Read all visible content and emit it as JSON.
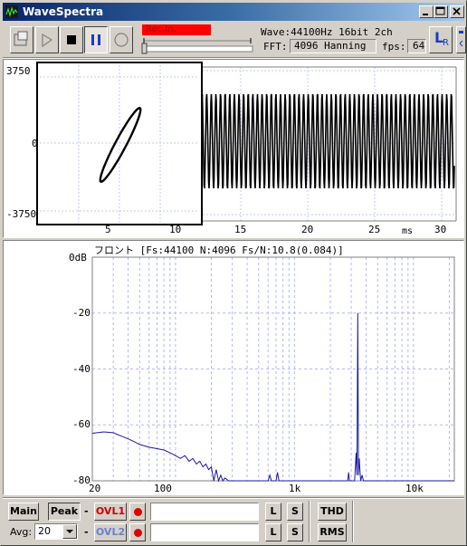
{
  "window": {
    "title": "WaveSpectra",
    "controls": [
      "minimize",
      "maximize",
      "close"
    ]
  },
  "toolbar": {
    "record_indicator": "Rec.In.",
    "wave_info": "Wave:44100Hz 16bit 2ch",
    "fft_label": "FFT:",
    "fft_value": "4096 Hanning",
    "fps_label": "fps:",
    "fps_value": "64",
    "lr_label": "L",
    "lr_sub": "R"
  },
  "wave_view": {
    "y_top": "3750",
    "y_mid": "0",
    "y_bottom": "-3750",
    "x_ticks": [
      "5",
      "10",
      "15",
      "20",
      "25",
      "30"
    ],
    "x_unit": "ms"
  },
  "spectrum_view": {
    "header": "フロント  [Fs:44100 N:4096 Fs/N:10.8(0.084)]",
    "y_ticks": [
      "0dB",
      "-20",
      "-40",
      "-60",
      "-80"
    ],
    "x_ticks": [
      "20",
      "100",
      "1k",
      "10k"
    ]
  },
  "bottom": {
    "main_label": "Main",
    "peak_label": "Peak",
    "dash": "-",
    "ovl1_label": "OVL1",
    "ovl2_label": "OVL2",
    "l_label": "L",
    "s_label": "S",
    "thd_label": "THD",
    "rms_label": "RMS",
    "avg_label": "Avg:",
    "avg_value": "20"
  },
  "colors": {
    "title_start": "#0a246a",
    "title_end": "#a6caf0",
    "wave_line": "#000000",
    "spectrum_line": "#1a1aa0",
    "grid": "#b0b8ff",
    "rec": "#ff0000",
    "ovl1": "#cc0000",
    "ovl2": "#6a7fd0"
  }
}
